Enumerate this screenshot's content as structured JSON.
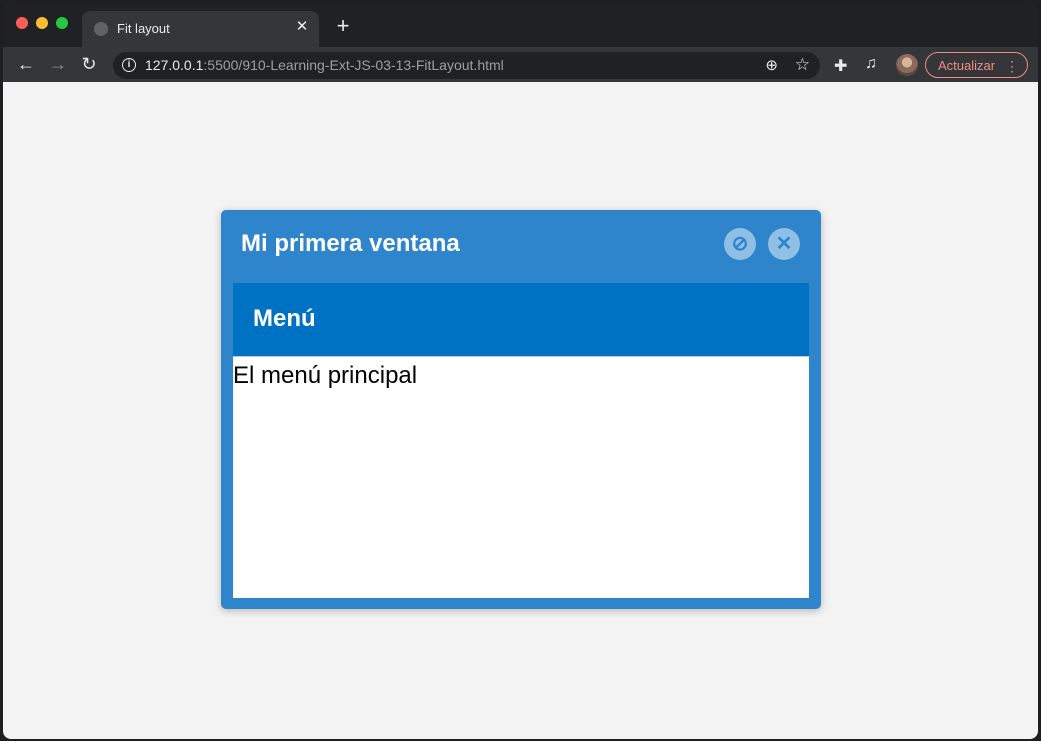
{
  "tab": {
    "title": "Fit layout",
    "close_glyph": "✕",
    "new_tab_glyph": "+"
  },
  "toolbar": {
    "back_glyph": "←",
    "forward_glyph": "→",
    "reload_glyph": "↻",
    "url_host": "127.0.0.1",
    "url_rest": ":5500/910-Learning-Ext-JS-03-13-FitLayout.html",
    "update_label": "Actualizar",
    "menu_glyph": "⋮"
  },
  "window": {
    "title": "Mi primera ventana",
    "panel_title": "Menú",
    "panel_text": "El menú principal"
  },
  "colors": {
    "window_blue": "#2e85cb",
    "panel_header_blue": "#0072c4",
    "update_accent": "#f28b82"
  },
  "icons": [
    "globe-icon",
    "info-icon",
    "zoom-icon",
    "star-icon",
    "extensions-icon",
    "media-icon",
    "collapse-icon",
    "close-icon"
  ]
}
